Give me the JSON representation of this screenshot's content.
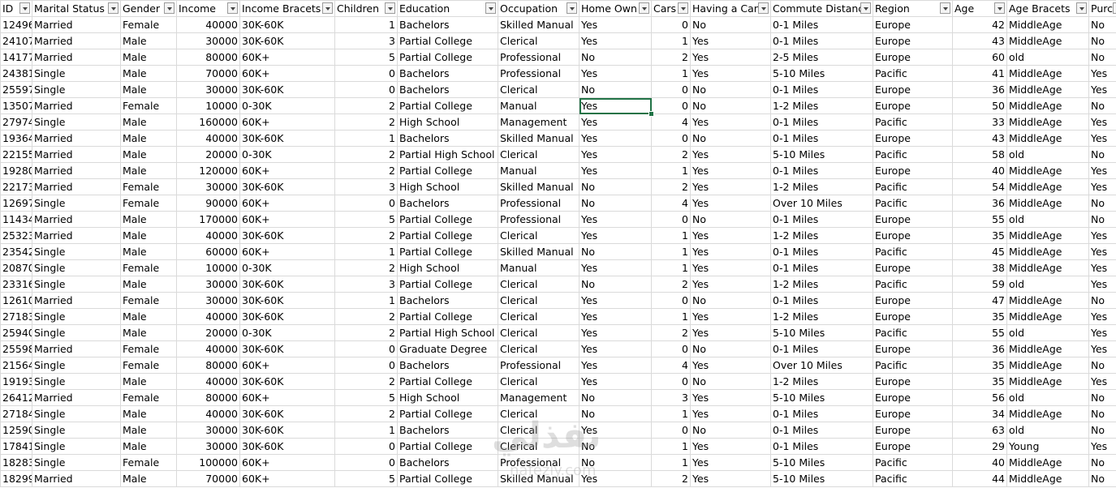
{
  "sheet": {
    "columns": [
      "ID",
      "Marital Status",
      "Gender",
      "Income",
      "Income Bracets",
      "Children",
      "Education",
      "Occupation",
      "Home Own",
      "Cars",
      "Having a Car",
      "Commute Distanc",
      "Region",
      "Age",
      "Age Bracets",
      "Purch"
    ],
    "rows": [
      [
        "12496",
        "Married",
        "Female",
        "40000",
        "30K-60K",
        "1",
        "Bachelors",
        "Skilled Manual",
        "Yes",
        "0",
        "No",
        "0-1 Miles",
        "Europe",
        "42",
        "MiddleAge",
        "No"
      ],
      [
        "24107",
        "Married",
        "Male",
        "30000",
        "30K-60K",
        "3",
        "Partial College",
        "Clerical",
        "Yes",
        "1",
        "Yes",
        "0-1 Miles",
        "Europe",
        "43",
        "MiddleAge",
        "No"
      ],
      [
        "14177",
        "Married",
        "Male",
        "80000",
        "60K+",
        "5",
        "Partial College",
        "Professional",
        "No",
        "2",
        "Yes",
        "2-5 Miles",
        "Europe",
        "60",
        "old",
        "No"
      ],
      [
        "24381",
        "Single",
        "Male",
        "70000",
        "60K+",
        "0",
        "Bachelors",
        "Professional",
        "Yes",
        "1",
        "Yes",
        "5-10 Miles",
        "Pacific",
        "41",
        "MiddleAge",
        "Yes"
      ],
      [
        "25597",
        "Single",
        "Male",
        "30000",
        "30K-60K",
        "0",
        "Bachelors",
        "Clerical",
        "No",
        "0",
        "No",
        "0-1 Miles",
        "Europe",
        "36",
        "MiddleAge",
        "Yes"
      ],
      [
        "13507",
        "Married",
        "Female",
        "10000",
        "0-30K",
        "2",
        "Partial College",
        "Manual",
        "Yes",
        "0",
        "No",
        "1-2 Miles",
        "Europe",
        "50",
        "MiddleAge",
        "No"
      ],
      [
        "27974",
        "Single",
        "Male",
        "160000",
        "60K+",
        "2",
        "High School",
        "Management",
        "Yes",
        "4",
        "Yes",
        "0-1 Miles",
        "Pacific",
        "33",
        "MiddleAge",
        "Yes"
      ],
      [
        "19364",
        "Married",
        "Male",
        "40000",
        "30K-60K",
        "1",
        "Bachelors",
        "Skilled Manual",
        "Yes",
        "0",
        "No",
        "0-1 Miles",
        "Europe",
        "43",
        "MiddleAge",
        "Yes"
      ],
      [
        "22155",
        "Married",
        "Male",
        "20000",
        "0-30K",
        "2",
        "Partial High School",
        "Clerical",
        "Yes",
        "2",
        "Yes",
        "5-10 Miles",
        "Pacific",
        "58",
        "old",
        "No"
      ],
      [
        "19280",
        "Married",
        "Male",
        "120000",
        "60K+",
        "2",
        "Partial College",
        "Manual",
        "Yes",
        "1",
        "Yes",
        "0-1 Miles",
        "Europe",
        "40",
        "MiddleAge",
        "Yes"
      ],
      [
        "22173",
        "Married",
        "Female",
        "30000",
        "30K-60K",
        "3",
        "High School",
        "Skilled Manual",
        "No",
        "2",
        "Yes",
        "1-2 Miles",
        "Pacific",
        "54",
        "MiddleAge",
        "Yes"
      ],
      [
        "12697",
        "Single",
        "Female",
        "90000",
        "60K+",
        "0",
        "Bachelors",
        "Professional",
        "No",
        "4",
        "Yes",
        "Over 10 Miles",
        "Pacific",
        "36",
        "MiddleAge",
        "No"
      ],
      [
        "11434",
        "Married",
        "Male",
        "170000",
        "60K+",
        "5",
        "Partial College",
        "Professional",
        "Yes",
        "0",
        "No",
        "0-1 Miles",
        "Europe",
        "55",
        "old",
        "No"
      ],
      [
        "25323",
        "Married",
        "Male",
        "40000",
        "30K-60K",
        "2",
        "Partial College",
        "Clerical",
        "Yes",
        "1",
        "Yes",
        "1-2 Miles",
        "Europe",
        "35",
        "MiddleAge",
        "Yes"
      ],
      [
        "23542",
        "Single",
        "Male",
        "60000",
        "60K+",
        "1",
        "Partial College",
        "Skilled Manual",
        "No",
        "1",
        "Yes",
        "0-1 Miles",
        "Pacific",
        "45",
        "MiddleAge",
        "Yes"
      ],
      [
        "20870",
        "Single",
        "Female",
        "10000",
        "0-30K",
        "2",
        "High School",
        "Manual",
        "Yes",
        "1",
        "Yes",
        "0-1 Miles",
        "Europe",
        "38",
        "MiddleAge",
        "Yes"
      ],
      [
        "23316",
        "Single",
        "Male",
        "30000",
        "30K-60K",
        "3",
        "Partial College",
        "Clerical",
        "No",
        "2",
        "Yes",
        "1-2 Miles",
        "Pacific",
        "59",
        "old",
        "Yes"
      ],
      [
        "12610",
        "Married",
        "Female",
        "30000",
        "30K-60K",
        "1",
        "Bachelors",
        "Clerical",
        "Yes",
        "0",
        "No",
        "0-1 Miles",
        "Europe",
        "47",
        "MiddleAge",
        "No"
      ],
      [
        "27183",
        "Single",
        "Male",
        "40000",
        "30K-60K",
        "2",
        "Partial College",
        "Clerical",
        "Yes",
        "1",
        "Yes",
        "1-2 Miles",
        "Europe",
        "35",
        "MiddleAge",
        "Yes"
      ],
      [
        "25940",
        "Single",
        "Male",
        "20000",
        "0-30K",
        "2",
        "Partial High School",
        "Clerical",
        "Yes",
        "2",
        "Yes",
        "5-10 Miles",
        "Pacific",
        "55",
        "old",
        "Yes"
      ],
      [
        "25598",
        "Married",
        "Female",
        "40000",
        "30K-60K",
        "0",
        "Graduate Degree",
        "Clerical",
        "Yes",
        "0",
        "No",
        "0-1 Miles",
        "Europe",
        "36",
        "MiddleAge",
        "Yes"
      ],
      [
        "21564",
        "Single",
        "Female",
        "80000",
        "60K+",
        "0",
        "Bachelors",
        "Professional",
        "Yes",
        "4",
        "Yes",
        "Over 10 Miles",
        "Pacific",
        "35",
        "MiddleAge",
        "No"
      ],
      [
        "19193",
        "Single",
        "Male",
        "40000",
        "30K-60K",
        "2",
        "Partial College",
        "Clerical",
        "Yes",
        "0",
        "No",
        "1-2 Miles",
        "Europe",
        "35",
        "MiddleAge",
        "Yes"
      ],
      [
        "26412",
        "Married",
        "Female",
        "80000",
        "60K+",
        "5",
        "High School",
        "Management",
        "No",
        "3",
        "Yes",
        "5-10 Miles",
        "Europe",
        "56",
        "old",
        "No"
      ],
      [
        "27184",
        "Single",
        "Male",
        "40000",
        "30K-60K",
        "2",
        "Partial College",
        "Clerical",
        "No",
        "1",
        "Yes",
        "0-1 Miles",
        "Europe",
        "34",
        "MiddleAge",
        "No"
      ],
      [
        "12590",
        "Single",
        "Male",
        "30000",
        "30K-60K",
        "1",
        "Bachelors",
        "Clerical",
        "Yes",
        "0",
        "No",
        "0-1 Miles",
        "Europe",
        "63",
        "old",
        "No"
      ],
      [
        "17841",
        "Single",
        "Male",
        "30000",
        "30K-60K",
        "0",
        "Partial College",
        "Clerical",
        "No",
        "1",
        "Yes",
        "0-1 Miles",
        "Europe",
        "29",
        "Young",
        "Yes"
      ],
      [
        "18283",
        "Single",
        "Female",
        "100000",
        "60K+",
        "0",
        "Bachelors",
        "Professional",
        "No",
        "1",
        "Yes",
        "5-10 Miles",
        "Pacific",
        "40",
        "MiddleAge",
        "No"
      ],
      [
        "18299",
        "Married",
        "Male",
        "70000",
        "60K+",
        "5",
        "Partial College",
        "Skilled Manual",
        "Yes",
        "2",
        "Yes",
        "5-10 Miles",
        "Pacific",
        "44",
        "MiddleAge",
        "No"
      ]
    ],
    "numeric_columns": [
      0,
      3,
      5,
      9,
      13
    ],
    "selected_cell": {
      "row": 5,
      "col": 8
    },
    "accent_color": "#217346"
  },
  "watermark": {
    "main": "نفذلي",
    "sub": "nafezly.com"
  }
}
